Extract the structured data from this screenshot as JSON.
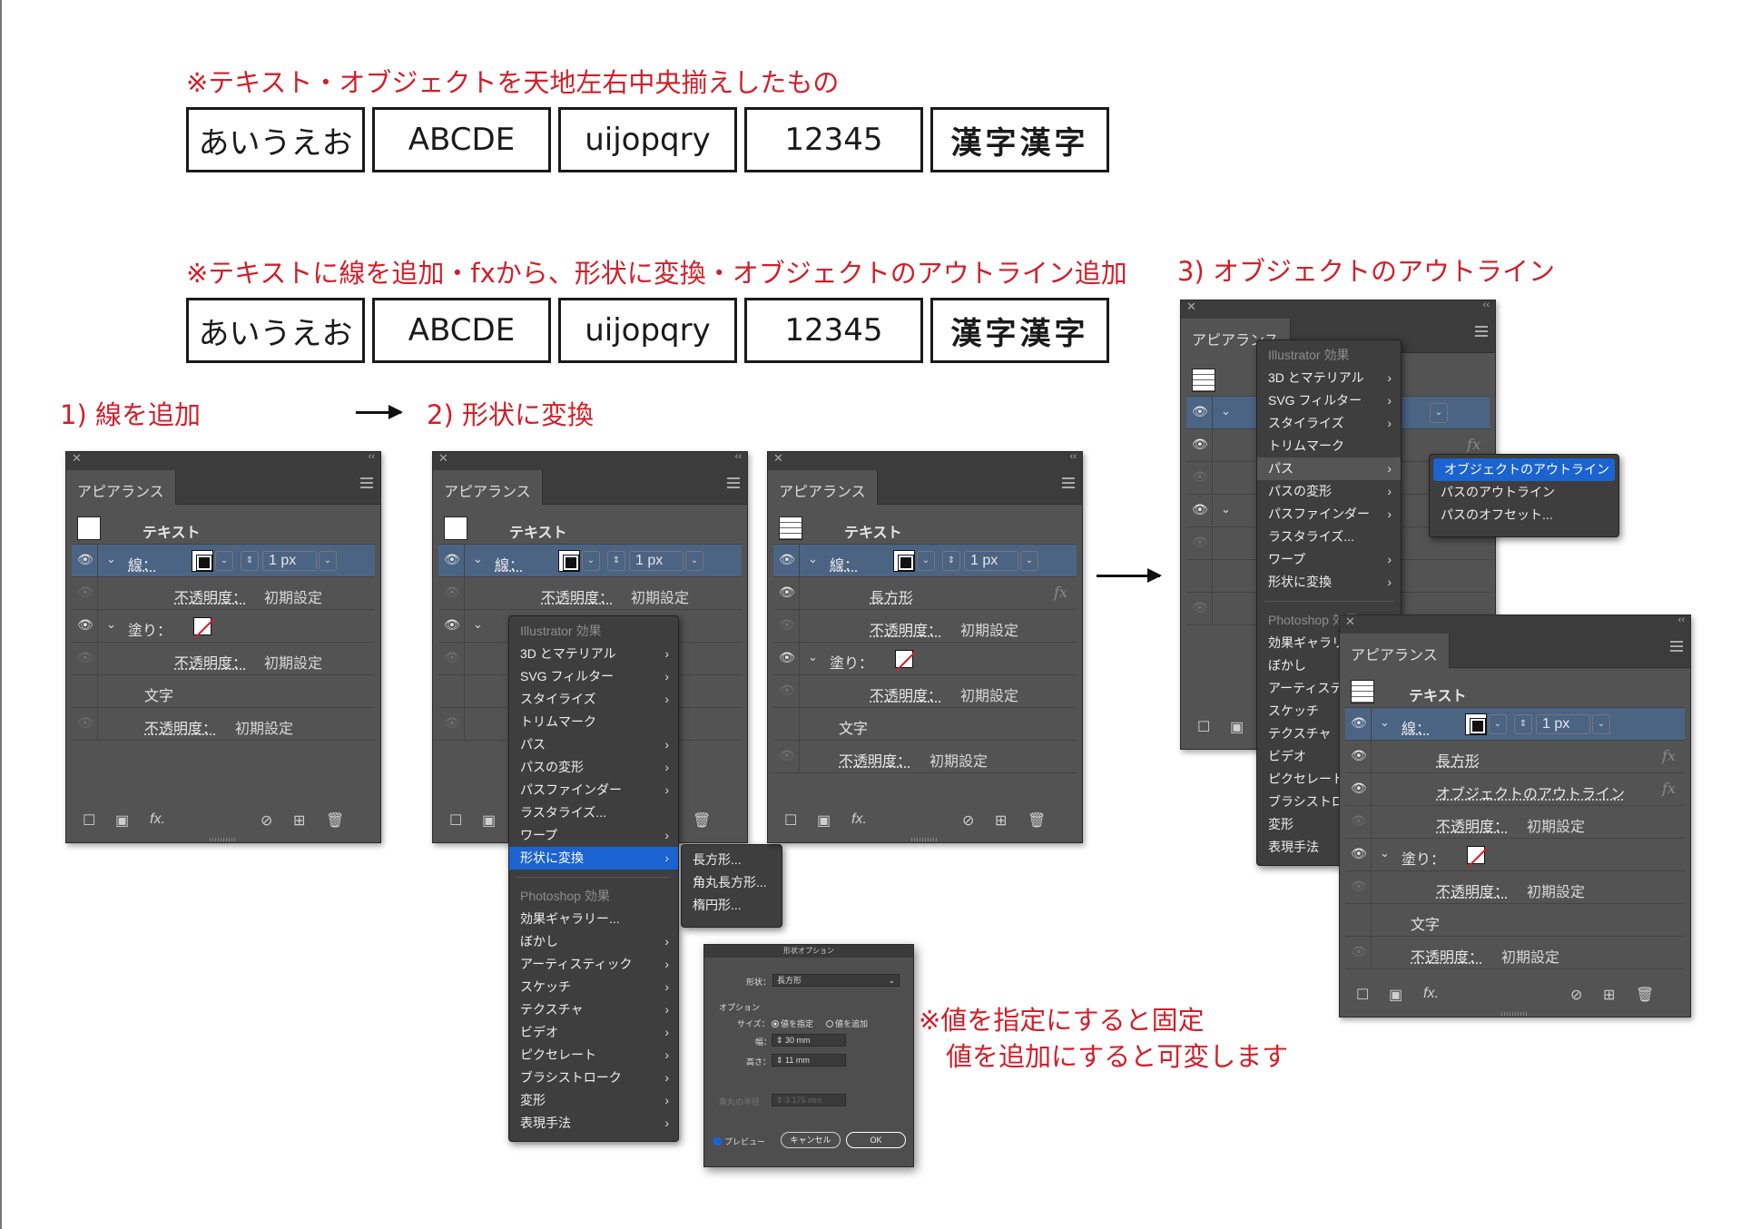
{
  "notes": {
    "top": "※テキスト・オブジェクトを天地左右中央揃えしたもの",
    "middle": "※テキストに線を追加・fxから、形状に変換・オブジェクトのアウトライン追加",
    "bottom_line1": "※値を指定にすると固定",
    "bottom_line2": "値を追加にすると可変します"
  },
  "sample_texts": [
    "あいうえお",
    "ABCDE",
    "uijopqry",
    "12345",
    "漢字漢字"
  ],
  "steps": {
    "step1": "1) 線を追加",
    "step2": "2) 形状に変換",
    "step3": "3) オブジェクトのアウトライン"
  },
  "appearance": {
    "tab": "アピアランス",
    "object": "テキスト",
    "stroke": "線：",
    "stroke_weight": "1 px",
    "opacity": "不透明度：",
    "default": "初期設定",
    "fill": "塗り：",
    "characters": "文字",
    "rectangle": "長方形",
    "outline_object": "オブジェクトのアウトライン",
    "fx": "fx"
  },
  "effect_menu": {
    "illustrator_header": "Illustrator 効果",
    "illustrator_items": [
      "3D とマテリアル",
      "SVG フィルター",
      "スタイライズ",
      "トリムマーク",
      "パス",
      "パスの変形",
      "パスファインダー",
      "ラスタライズ...",
      "ワープ",
      "形状に変換"
    ],
    "photoshop_header": "Photoshop 効果",
    "photoshop_items": [
      "効果ギャラリー...",
      "ぼかし",
      "アーティスティック",
      "スケッチ",
      "テクスチャ",
      "ビデオ",
      "ピクセレート",
      "ブラシストローク",
      "変形",
      "表現手法"
    ]
  },
  "shape_submenu": [
    "長方形...",
    "角丸長方形...",
    "楕円形..."
  ],
  "path_submenu": [
    "オブジェクトのアウトライン",
    "パスのアウトライン",
    "パスのオフセット..."
  ],
  "dialog": {
    "title": "形状オプション",
    "shape_label": "形状：",
    "shape_value": "長方形",
    "options_label": "オプション",
    "size_label": "サイズ：",
    "absolute": "値を指定",
    "relative": "値を追加",
    "width_label": "幅：",
    "width_value": "30 mm",
    "height_label": "高さ：",
    "height_value": "11 mm",
    "corner_label": "角丸の半径",
    "corner_value": "3.175 mm",
    "preview": "プレビュー",
    "cancel": "キャンセル",
    "ok": "OK"
  },
  "colors": {
    "accent_red": "#d0202a",
    "selection_blue": "#4b6484",
    "highlight_blue": "#1b63d0",
    "panel_bg": "#535353"
  }
}
